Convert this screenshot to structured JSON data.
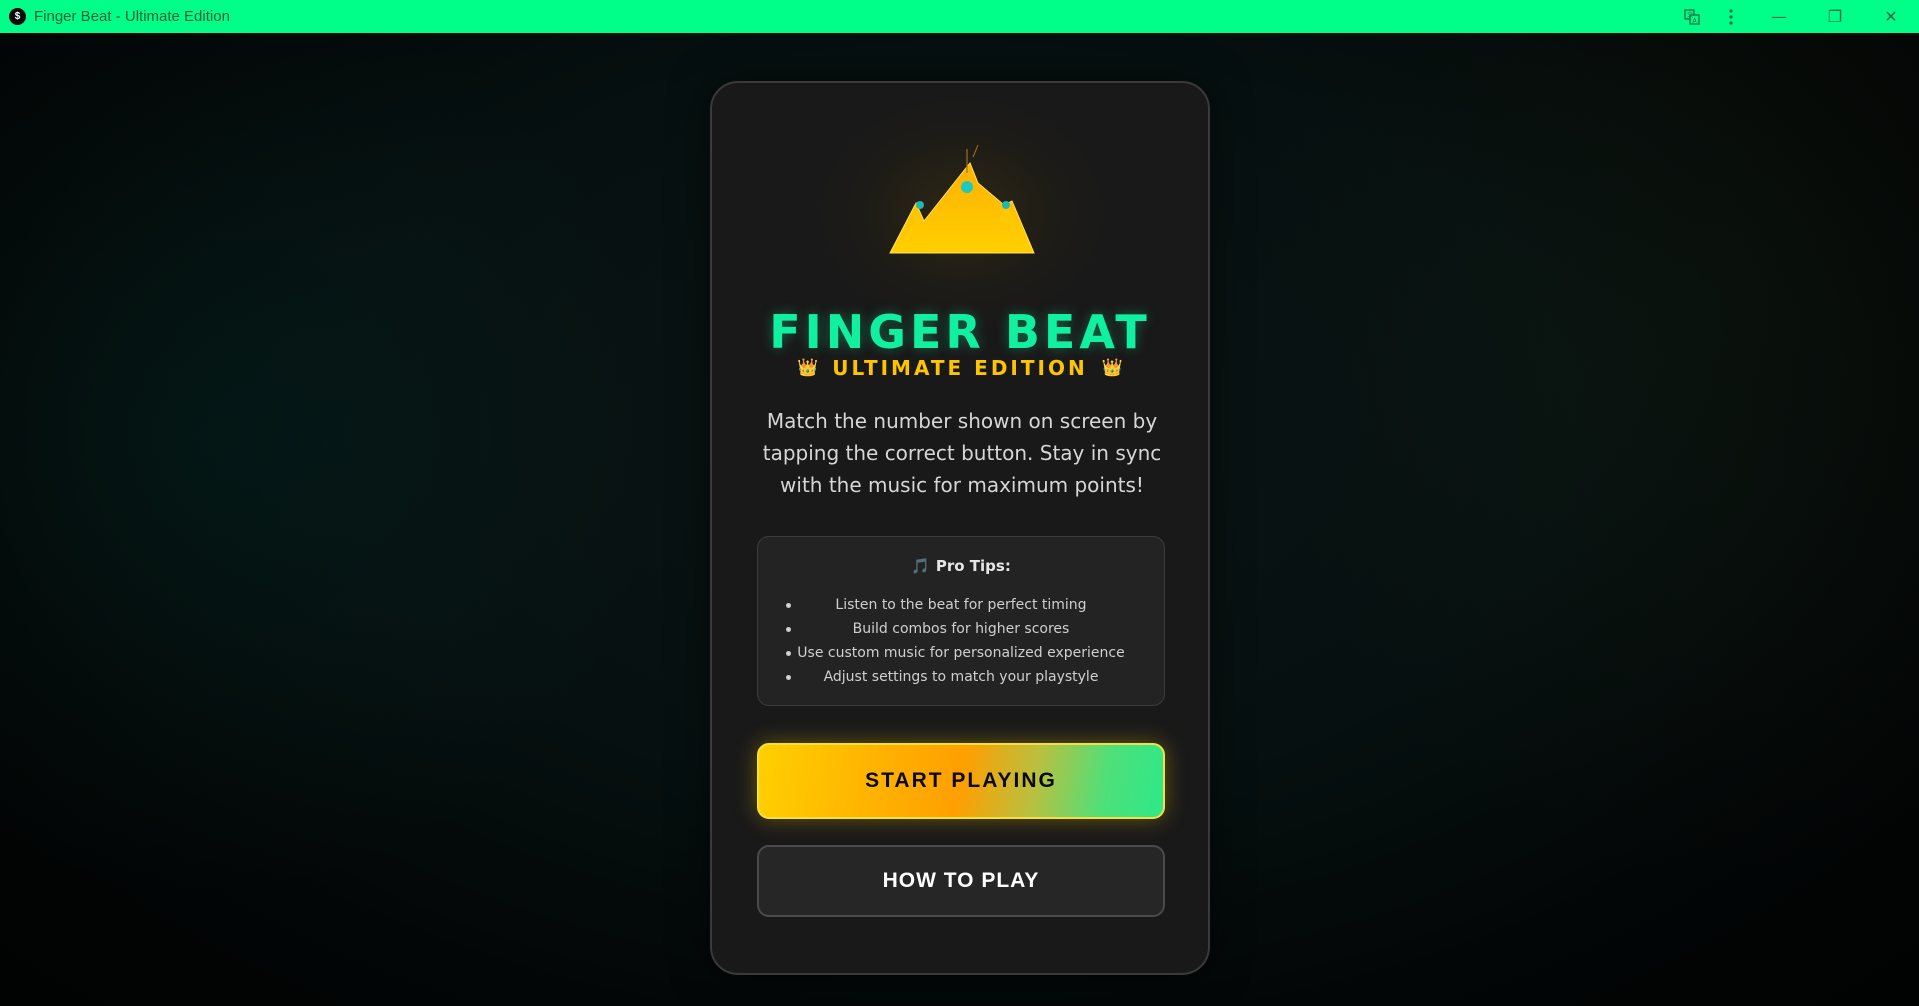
{
  "window": {
    "title": "Finger Beat - Ultimate Edition",
    "app_icon_letter": "$",
    "controls": {
      "translate_icon": "translate-icon",
      "menu_icon": "more-vertical-icon",
      "minimize_glyph": "—",
      "restore_glyph": "❐",
      "close_glyph": "✕"
    }
  },
  "colors": {
    "titlebar": "#00ff88",
    "title_accent": "#10f0a0",
    "edition_accent": "#ffc400",
    "card_bg": "#191919"
  },
  "hero": {
    "logo_icon": "crown-icon",
    "title": "FINGER BEAT",
    "edition_left_icon": "👑",
    "edition": "ULTIMATE EDITION",
    "edition_right_icon": "👑",
    "description": "Match the number shown on screen by tapping the correct button. Stay in sync with the music for maximum points!"
  },
  "tips": {
    "icon": "🎵",
    "heading": "Pro Tips:",
    "items": [
      "Listen to the beat for perfect timing",
      "Build combos for higher scores",
      "Use custom music for personalized experience",
      "Adjust settings to match your playstyle"
    ]
  },
  "buttons": {
    "start": "START PLAYING",
    "how_to": "HOW TO PLAY"
  }
}
